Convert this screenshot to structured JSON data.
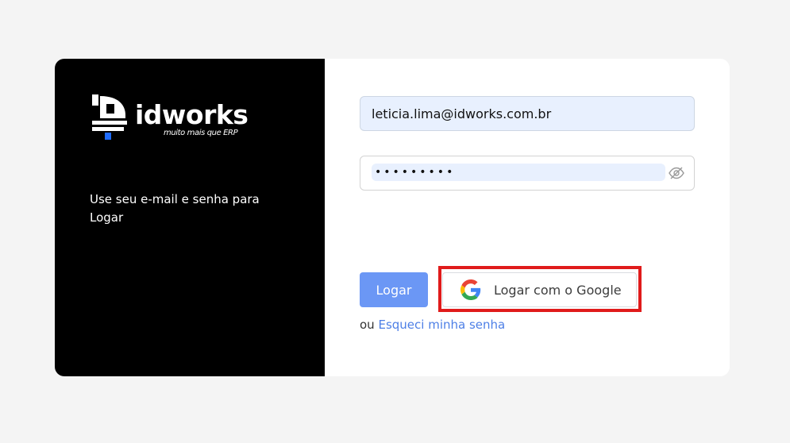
{
  "brand": {
    "name": "idworks",
    "tagline": "muito mais que ERP"
  },
  "left_panel": {
    "description": "Use seu e-mail e senha para Logar"
  },
  "form": {
    "email_value": "leticia.lima@idworks.com.br",
    "password_value": "•••••••••",
    "password_toggle_icon": "eye-off-icon",
    "login_label": "Logar",
    "google_label": "Logar com o Google",
    "or_text": "ou",
    "forgot_label": "Esqueci minha senha"
  },
  "colors": {
    "left_panel_bg": "#000000",
    "login_button_bg": "#6b97f5",
    "link": "#4d7fe6",
    "highlight_border": "#e01b1b",
    "autofill_bg": "#e8f0fe"
  }
}
